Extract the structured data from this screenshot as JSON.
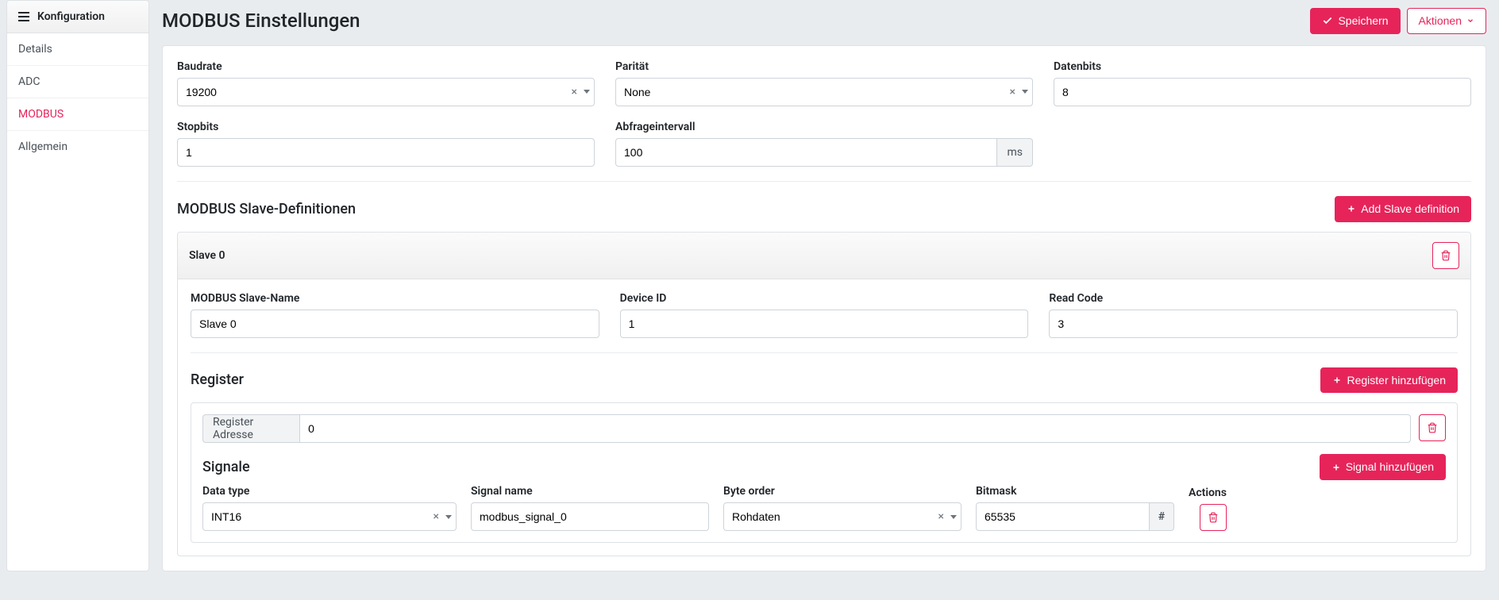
{
  "colors": {
    "accent": "#e6245a"
  },
  "sidebar": {
    "title": "Konfiguration",
    "items": [
      {
        "label": "Details"
      },
      {
        "label": "ADC"
      },
      {
        "label": "MODBUS"
      },
      {
        "label": "Allgemein"
      }
    ],
    "active_index": 2
  },
  "header": {
    "title": "MODBUS Einstellungen",
    "save_label": "Speichern",
    "actions_label": "Aktionen"
  },
  "settings": {
    "baudrate": {
      "label": "Baudrate",
      "value": "19200"
    },
    "parity": {
      "label": "Parität",
      "value": "None"
    },
    "databits": {
      "label": "Datenbits",
      "value": "8"
    },
    "stopbits": {
      "label": "Stopbits",
      "value": "1"
    },
    "interval": {
      "label": "Abfrageintervall",
      "value": "100",
      "unit": "ms"
    }
  },
  "slaves": {
    "section_title": "MODBUS Slave-Definitionen",
    "add_label": "Add Slave definition",
    "panels": [
      {
        "title": "Slave 0",
        "fields": {
          "name": {
            "label": "MODBUS Slave-Name",
            "value": "Slave 0"
          },
          "device_id": {
            "label": "Device ID",
            "value": "1"
          },
          "read_code": {
            "label": "Read Code",
            "value": "3"
          }
        },
        "registers": {
          "section_title": "Register",
          "add_label": "Register hinzufügen",
          "address_label": "Register Adresse",
          "items": [
            {
              "address": "0",
              "signals": {
                "section_title": "Signale",
                "add_label": "Signal hinzufügen",
                "columns": {
                  "data_type": "Data type",
                  "signal_name": "Signal name",
                  "byte_order": "Byte order",
                  "bitmask": "Bitmask",
                  "actions": "Actions"
                },
                "rows": [
                  {
                    "data_type": "INT16",
                    "signal_name": "modbus_signal_0",
                    "byte_order": "Rohdaten",
                    "bitmask": "65535",
                    "hash": "#"
                  }
                ]
              }
            }
          ]
        }
      }
    ]
  }
}
